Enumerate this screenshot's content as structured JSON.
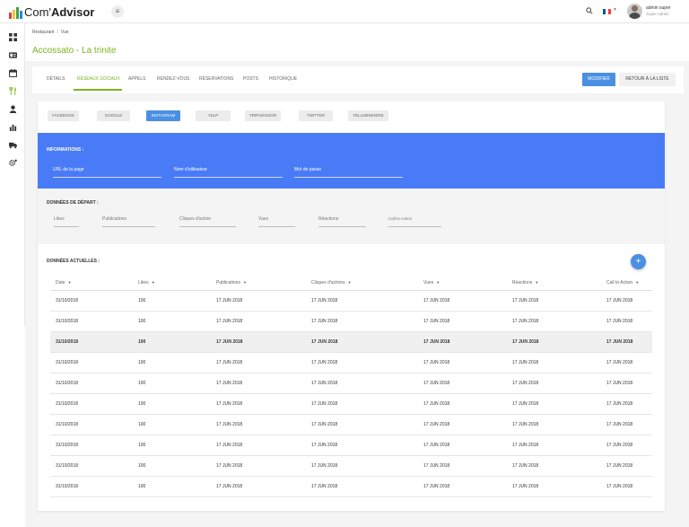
{
  "brand": {
    "name_prefix": "Com'",
    "name_bold": "Advisor",
    "bar_colors": [
      "#e53935",
      "#fbc02d",
      "#43a047",
      "#1e88e5"
    ]
  },
  "topbar": {
    "menu_icon": "≡",
    "user_name": "admin super",
    "user_role": "Super admin",
    "flag_colors": [
      "#0055a4",
      "#ffffff",
      "#ef4135"
    ]
  },
  "sidebar": {
    "icons": [
      "dashboard-icon",
      "id-card-icon",
      "calendar-icon",
      "restaurant-icon",
      "user-icon",
      "chart-icon",
      "truck-icon",
      "settings-icon"
    ]
  },
  "breadcrumb": {
    "items": [
      "Restaurant",
      "Vue"
    ],
    "separator": "/"
  },
  "page": {
    "title": "Accossato - La trinite"
  },
  "tabs": {
    "items": [
      "DÉTAILS",
      "RÉSEAUX SOCIAUX",
      "APPELS",
      "RENDEZ-VOUS",
      "RÉSERVATIONS",
      "POSTS",
      "HISTORIQUE"
    ],
    "active": "RÉSEAUX SOCIAUX"
  },
  "actions": {
    "edit_label": "MODIFIER",
    "back_label": "RETOUR À LA LISTE"
  },
  "socials": {
    "items": [
      "FACEBOOK",
      "GOOGLE",
      "INSTAGRAM",
      "YELP",
      "TRIPADVISOR",
      "TWITTER",
      "TELLMEWHERE"
    ],
    "active": "INSTAGRAM"
  },
  "info": {
    "title": "INFORMATIONS :",
    "fields": [
      "URL de la page",
      "Nom d'utilisateur",
      "Mot de passe"
    ]
  },
  "start": {
    "title": "DONNÉES DE DÉPART :",
    "fields": [
      "Likes",
      "Publications",
      "Cliques d'action",
      "Vues",
      "Réactions",
      "Call to Action"
    ]
  },
  "current": {
    "title": "DONNÉES ACTUELLES :",
    "add_icon": "+",
    "columns": [
      "Date",
      "Likes",
      "Publications",
      "Cliques d'actions",
      "Vues",
      "Réactions",
      "Call to Action"
    ],
    "sort_icon": "▼",
    "rows": [
      [
        "31/10/2018",
        "100",
        "17 JUN 2018",
        "17 JUN 2018",
        "17 JUN 2018",
        "17 JUN 2018",
        "17 JUN 2018"
      ],
      [
        "31/10/2018",
        "100",
        "17 JUN 2018",
        "17 JUN 2018",
        "17 JUN 2018",
        "17 JUN 2018",
        "17 JUN 2018"
      ],
      [
        "31/10/2018",
        "100",
        "17 JUN 2018",
        "17 JUN 2018",
        "17 JUN 2018",
        "17 JUN 2018",
        "17 JUN 2018"
      ],
      [
        "31/10/2018",
        "100",
        "17 JUN 2018",
        "17 JUN 2018",
        "17 JUN 2018",
        "17 JUN 2018",
        "17 JUN 2018"
      ],
      [
        "31/10/2018",
        "100",
        "17 JUN 2018",
        "17 JUN 2018",
        "17 JUN 2018",
        "17 JUN 2018",
        "17 JUN 2018"
      ],
      [
        "31/10/2018",
        "100",
        "17 JUN 2018",
        "17 JUN 2018",
        "17 JUN 2018",
        "17 JUN 2018",
        "17 JUN 2018"
      ],
      [
        "31/10/2018",
        "100",
        "17 JUN 2018",
        "17 JUN 2018",
        "17 JUN 2018",
        "17 JUN 2018",
        "17 JUN 2018"
      ],
      [
        "31/10/2018",
        "100",
        "17 JUN 2018",
        "17 JUN 2018",
        "17 JUN 2018",
        "17 JUN 2018",
        "17 JUN 2018"
      ],
      [
        "31/10/2018",
        "100",
        "17 JUN 2018",
        "17 JUN 2018",
        "17 JUN 2018",
        "17 JUN 2018",
        "17 JUN 2018"
      ],
      [
        "31/10/2018",
        "100",
        "17 JUN 2018",
        "17 JUN 2018",
        "17 JUN 2018",
        "17 JUN 2018",
        "17 JUN 2018"
      ]
    ],
    "highlighted_row": 2
  },
  "colors": {
    "accent_green": "#7ab51d",
    "primary_blue": "#4a90e2",
    "info_blue": "#4a7bf7"
  }
}
